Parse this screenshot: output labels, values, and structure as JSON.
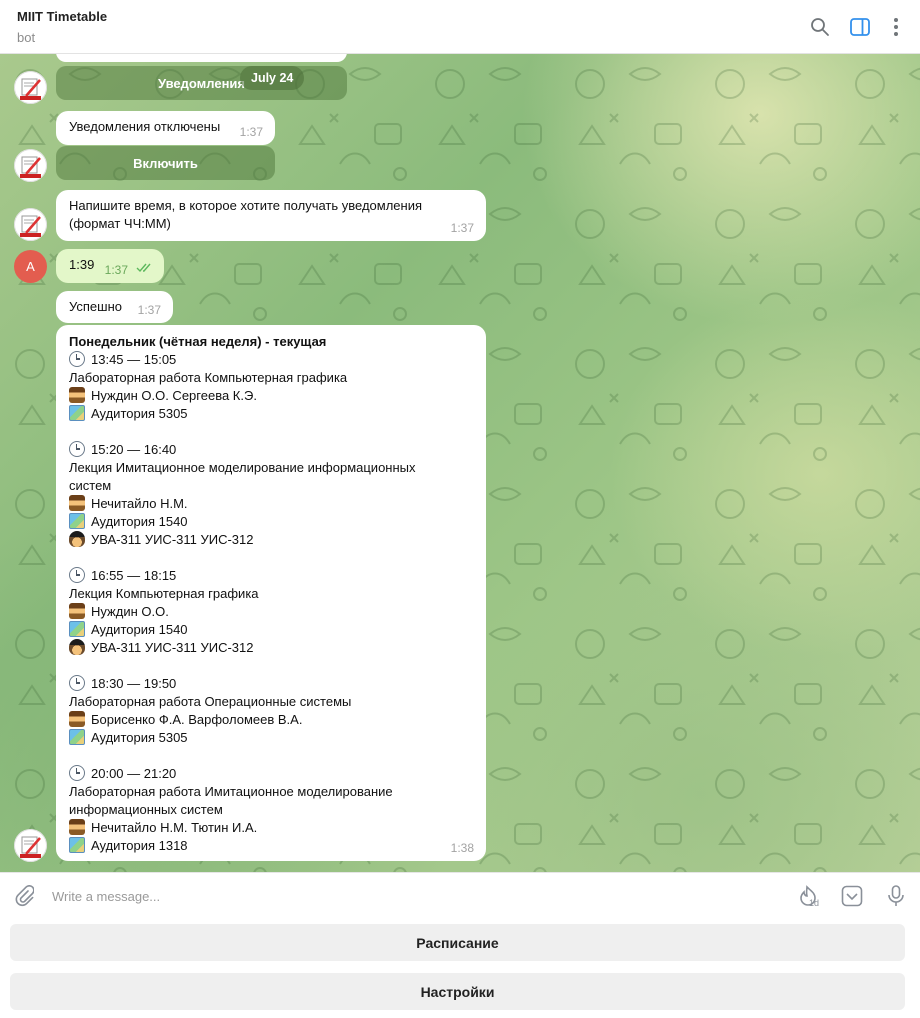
{
  "header": {
    "title": "MIIT Timetable",
    "subtitle": "bot"
  },
  "chat": {
    "date_pill": "July 24",
    "messages": [
      {
        "type": "bot-button",
        "label": "Уведомления"
      },
      {
        "type": "bot",
        "text": "Уведомления отключены",
        "time": "1:37"
      },
      {
        "type": "bot-button",
        "label": "Включить"
      },
      {
        "type": "bot",
        "text": "Напишите время, в которое хотите получать уведомления (формат ЧЧ:ММ)",
        "time": "1:37"
      },
      {
        "type": "user",
        "avatar_letter": "A",
        "text": "1:39",
        "time": "1:37",
        "status": "read"
      },
      {
        "type": "bot",
        "text": "Успешно",
        "time": "1:37"
      }
    ],
    "schedule": {
      "time": "1:38",
      "heading": "Понедельник (чётная неделя) - текущая",
      "lessons": [
        {
          "time": "13:45 — 15:05",
          "title": [
            "Лабораторная работа Компьютерная графика"
          ],
          "teacher": "Нуждин О.О. Сергеева К.Э.",
          "room": "Аудитория 5305",
          "groups": ""
        },
        {
          "time": "15:20 — 16:40",
          "title": [
            "Лекция Имитационное моделирование информационных",
            "систем"
          ],
          "teacher": "Нечитайло Н.М.",
          "room": "Аудитория 1540",
          "groups": "УВА-311 УИС-311 УИС-312"
        },
        {
          "time": "16:55 — 18:15",
          "title": [
            "Лекция Компьютерная графика"
          ],
          "teacher": "Нуждин О.О.",
          "room": "Аудитория 1540",
          "groups": "УВА-311 УИС-311 УИС-312"
        },
        {
          "time": "18:30 — 19:50",
          "title": [
            "Лабораторная работа Операционные системы"
          ],
          "teacher": "Борисенко Ф.А. Варфоломеев В.А.",
          "room": "Аудитория 5305",
          "groups": ""
        },
        {
          "time": "20:00 — 21:20",
          "title": [
            "Лабораторная работа Имитационное моделирование",
            "информационных систем"
          ],
          "teacher": "Нечитайло Н.М. Тютин И.А.",
          "room": "Аудитория 1318",
          "groups": ""
        }
      ]
    }
  },
  "composer": {
    "placeholder": "Write a message...",
    "timer_badge": "1d"
  },
  "keyboard": {
    "buttons": [
      "Расписание",
      "Настройки"
    ]
  },
  "colors": {
    "accent": "#3390ec",
    "outgoing_bubble": "#e3f7c9",
    "user_avatar": "#e35d4f"
  }
}
